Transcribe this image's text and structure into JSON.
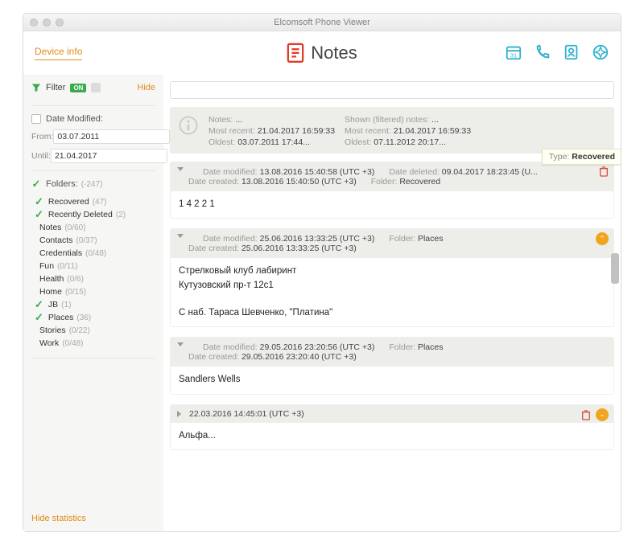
{
  "window": {
    "title": "Elcomsoft Phone Viewer"
  },
  "top": {
    "device_info": "Device info",
    "heading": "Notes"
  },
  "sidebar": {
    "filter_label": "Filter",
    "toggle_on": "ON",
    "hide_label": "Hide",
    "date_modified_label": "Date Modified:",
    "from_label": "From:",
    "from_value": "03.07.2011",
    "until_label": "Until:",
    "until_value": "21.04.2017",
    "folders_label": "Folders:",
    "folders_count": "(-247)",
    "folders": [
      {
        "name": "Recovered",
        "count": "(47)",
        "checked": true
      },
      {
        "name": "Recently Deleted",
        "count": "(2)",
        "checked": true
      },
      {
        "name": "Notes",
        "count": "(0/60)",
        "checked": false
      },
      {
        "name": "Contacts",
        "count": "(0/37)",
        "checked": false
      },
      {
        "name": "Credentials",
        "count": "(0/48)",
        "checked": false
      },
      {
        "name": "Fun",
        "count": "(0/11)",
        "checked": false
      },
      {
        "name": "Health",
        "count": "(0/6)",
        "checked": false
      },
      {
        "name": "Home",
        "count": "(0/15)",
        "checked": false
      },
      {
        "name": "JB",
        "count": "(1)",
        "checked": true
      },
      {
        "name": "Places",
        "count": "(36)",
        "checked": true
      },
      {
        "name": "Stories",
        "count": "(0/22)",
        "checked": false
      },
      {
        "name": "Work",
        "count": "(0/48)",
        "checked": false
      }
    ],
    "hide_stats": "Hide statistics"
  },
  "search": {
    "placeholder": ""
  },
  "stats": {
    "left": {
      "notes_label": "Notes:",
      "notes_value": "...",
      "most_recent_label": "Most recent:",
      "most_recent_value": "21.04.2017 16:59:33",
      "oldest_label": "Oldest:",
      "oldest_value": "03.07.2011 17:44..."
    },
    "right": {
      "shown_label": "Shown (filtered) notes:",
      "shown_value": "...",
      "most_recent_label": "Most recent:",
      "most_recent_value": "21.04.2017 16:59:33",
      "oldest_label": "Oldest:",
      "oldest_value": "07.11.2012 20:17..."
    }
  },
  "type_popover": {
    "label": "Type:",
    "value": "Recovered"
  },
  "notes": [
    {
      "dm_label": "Date modified:",
      "dm_value": "13.08.2016 15:40:58 (UTC +3)",
      "dd_label": "Date deleted:",
      "dd_value": "09.04.2017 18:23:45 (U...",
      "dc_label": "Date created:",
      "dc_value": "13.08.2016 15:40:50 (UTC +3)",
      "folder_label": "Folder:",
      "folder_value": "Recovered",
      "body_line1": "1 4 2 2 1",
      "body_line2": "",
      "body_line3": "",
      "has_trash": true,
      "has_circle": false
    },
    {
      "dm_label": "Date modified:",
      "dm_value": "25.06.2016 13:33:25 (UTC +3)",
      "dd_label": "",
      "dd_value": "",
      "dc_label": "Date created:",
      "dc_value": "25.06.2016 13:33:25 (UTC +3)",
      "folder_label": "Folder:",
      "folder_value": "Places",
      "body_line1": "Стрелковый клуб лабиринт",
      "body_line2": "Кутузовский пр-т 12с1",
      "body_line3": "С наб. Тараса Шевченко, \"Платина\"",
      "has_trash": false,
      "has_circle": true
    },
    {
      "dm_label": "Date modified:",
      "dm_value": "29.05.2016 23:20:56 (UTC +3)",
      "dd_label": "",
      "dd_value": "",
      "dc_label": "Date created:",
      "dc_value": "29.05.2016 23:20:40 (UTC +3)",
      "folder_label": "Folder:",
      "folder_value": "Places",
      "body_line1": "Sandlers Wells",
      "body_line2": "",
      "body_line3": "",
      "has_trash": false,
      "has_circle": false
    }
  ],
  "mini_note": {
    "date": "22.03.2016 14:45:01 (UTC +3)",
    "body": "Альфа..."
  }
}
